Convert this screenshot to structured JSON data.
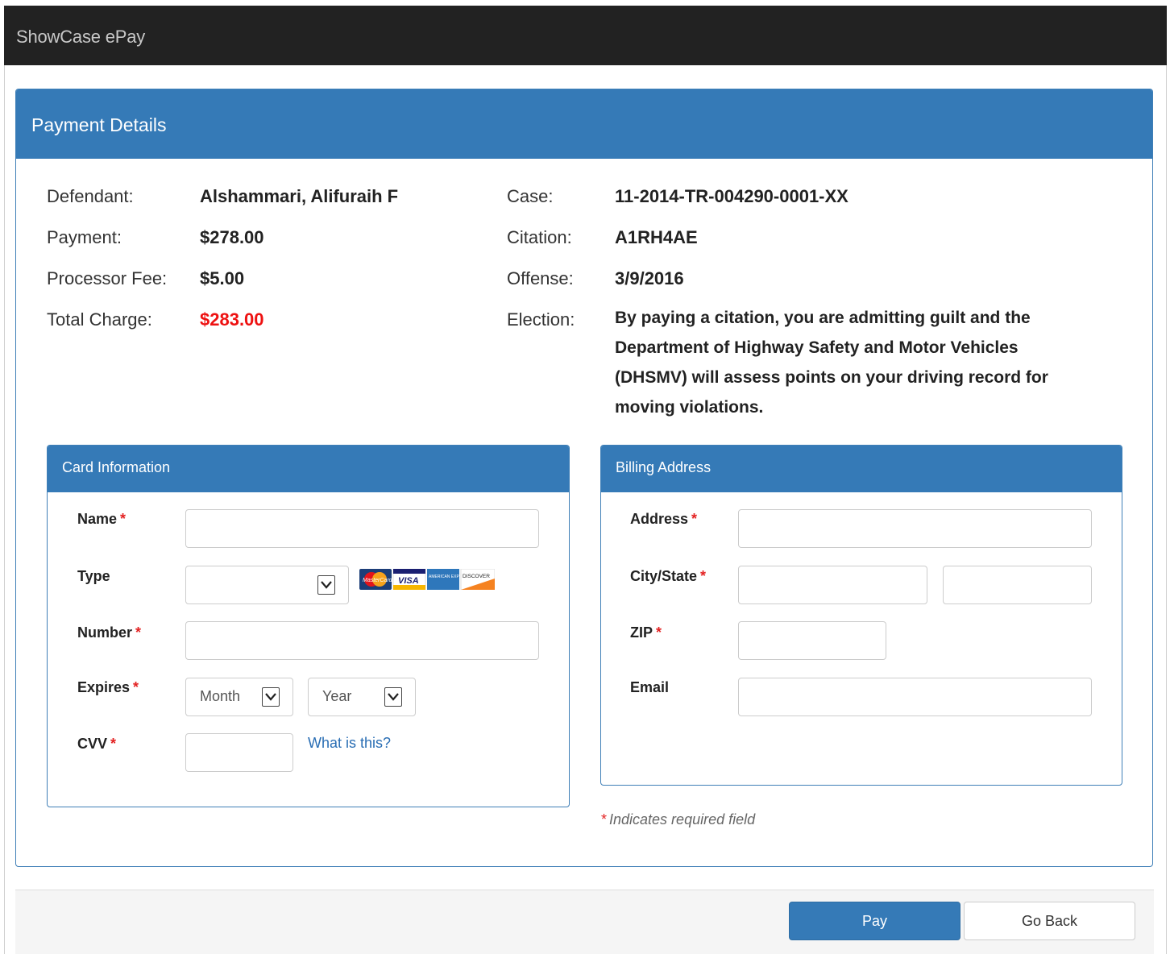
{
  "app": {
    "title": "ShowCase ePay"
  },
  "panel": {
    "title": "Payment Details"
  },
  "details": {
    "defendant_label": "Defendant:",
    "defendant_value": "Alshammari, Alifuraih F",
    "payment_label": "Payment:",
    "payment_value": "$278.00",
    "fee_label": "Processor Fee:",
    "fee_value": "$5.00",
    "total_label": "Total Charge:",
    "total_value": "$283.00",
    "case_label": "Case:",
    "case_value": "11-2014-TR-004290-0001-XX",
    "citation_label": "Citation:",
    "citation_value": "A1RH4AE",
    "offense_label": "Offense:",
    "offense_value": "3/9/2016",
    "election_label": "Election:",
    "election_value": "By paying a citation, you are admitting guilt and the Department of Highway Safety and Motor Vehicles (DHSMV) will assess points on your driving record for moving violations."
  },
  "card": {
    "title": "Card Information",
    "name_label": "Name",
    "type_label": "Type",
    "number_label": "Number",
    "expires_label": "Expires",
    "cvv_label": "CVV",
    "required_mark": "*",
    "name_value": "",
    "type_value": "",
    "number_value": "",
    "month_value": "Month",
    "year_value": "Year",
    "cvv_value": "",
    "cvv_help": "What is this?",
    "card_logos": {
      "mastercard": "MasterCard",
      "visa": "VISA",
      "amex": "AMERICAN EXPRESS",
      "discover": "DISCOVER"
    }
  },
  "billing": {
    "title": "Billing Address",
    "address_label": "Address",
    "city_state_label": "City/State",
    "zip_label": "ZIP",
    "email_label": "Email",
    "address_value": "",
    "city_value": "",
    "state_value": "",
    "zip_value": "",
    "email_value": ""
  },
  "note": {
    "star": "*",
    "text": "Indicates required field"
  },
  "buttons": {
    "pay": "Pay",
    "back": "Go Back"
  },
  "colors": {
    "accent": "#357ab7",
    "header_bar": "#222222",
    "required": "#e32222",
    "total": "#ee1111",
    "link": "#2a6eb4"
  }
}
